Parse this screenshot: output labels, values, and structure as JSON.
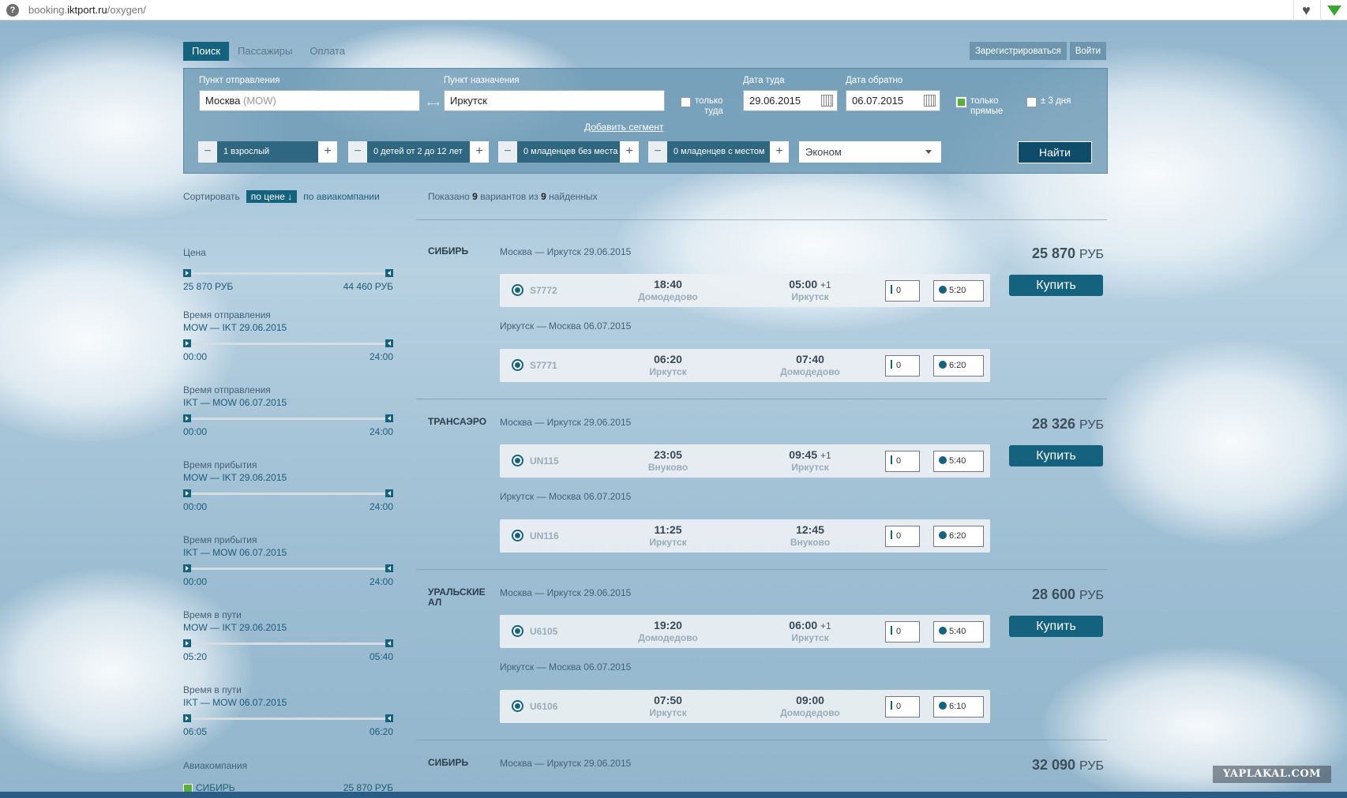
{
  "browser": {
    "url_prefix": "booking.",
    "url_domain": "iktport.ru",
    "url_path": "/oxygen/"
  },
  "tabs": [
    "Поиск",
    "Пассажиры",
    "Оплата"
  ],
  "auth": {
    "register": "Зарегистрироваться",
    "login": "Войти"
  },
  "search": {
    "from_label": "Пункт отправления",
    "from_value": "Москва",
    "from_code": "(MOW)",
    "to_label": "Пункт назначения",
    "to_value": "Иркутск",
    "one_way_line1": "только",
    "one_way_line2": "туда",
    "date_out_label": "Дата туда",
    "date_out": "29.06.2015",
    "date_back_label": "Дата обратно",
    "date_back": "06.07.2015",
    "direct_line1": "только",
    "direct_line2": "прямые",
    "plus_minus_3": "± 3 дня",
    "add_segment": "Добавить сегмент",
    "adults": "1 взрослый",
    "children": "0 детей от 2 до 12 лет",
    "infants_no_seat": "0 младенцев без места",
    "infants_seat": "0 младенцев с местом",
    "class": "Эконом",
    "find": "Найти"
  },
  "sort": {
    "label": "Сортировать",
    "by_price": "по цене ↓",
    "by_airline": "по авиакомпании"
  },
  "results_info": {
    "prefix": "Показано",
    "shown": "9",
    "middle": "вариантов из",
    "found": "9",
    "suffix": "найденных"
  },
  "filters": [
    {
      "title": "Цена",
      "subtitle": "",
      "min": "25 870 РУБ",
      "max": "44 460 РУБ"
    },
    {
      "title": "Время отправления",
      "subtitle": "MOW — IKT 29.06.2015",
      "min": "00:00",
      "max": "24:00"
    },
    {
      "title": "Время отправления",
      "subtitle": "IKT — MOW 06.07.2015",
      "min": "00:00",
      "max": "24:00"
    },
    {
      "title": "Время прибытия",
      "subtitle": "MOW — IKT 29.06.2015",
      "min": "00:00",
      "max": "24:00"
    },
    {
      "title": "Время прибытия",
      "subtitle": "IKT — MOW 06.07.2015",
      "min": "00:00",
      "max": "24:00"
    },
    {
      "title": "Время в пути",
      "subtitle": "MOW — IKT 29.06.2015",
      "min": "05:20",
      "max": "05:40"
    },
    {
      "title": "Время в пути",
      "subtitle": "IKT — MOW 06.07.2015",
      "min": "06:05",
      "max": "06:20"
    }
  ],
  "airline_filter": {
    "title": "Авиакомпания",
    "item": "СИБИРЬ",
    "price": "25 870 РУБ"
  },
  "offers": [
    {
      "airline": "СИБИРЬ",
      "price": "25 870",
      "currency": "РУБ",
      "buy": "Купить",
      "out": {
        "route": "Москва — Иркутск 29.06.2015",
        "num": "S7772",
        "dep": "18:40",
        "dep_ap": "Домодедово",
        "arr": "05:00",
        "plus": "+1",
        "arr_ap": "Иркутск",
        "stops": "0",
        "dur": "5:20"
      },
      "back": {
        "route": "Иркутск — Москва 06.07.2015",
        "num": "S7771",
        "dep": "06:20",
        "dep_ap": "Иркутск",
        "arr": "07:40",
        "plus": "",
        "arr_ap": "Домодедово",
        "stops": "0",
        "dur": "6:20"
      }
    },
    {
      "airline": "ТРАНСАЭРО",
      "price": "28 326",
      "currency": "РУБ",
      "buy": "Купить",
      "out": {
        "route": "Москва — Иркутск 29.06.2015",
        "num": "UN115",
        "dep": "23:05",
        "dep_ap": "Внуково",
        "arr": "09:45",
        "plus": "+1",
        "arr_ap": "Иркутск",
        "stops": "0",
        "dur": "5:40"
      },
      "back": {
        "route": "Иркутск — Москва 06.07.2015",
        "num": "UN116",
        "dep": "11:25",
        "dep_ap": "Иркутск",
        "arr": "12:45",
        "plus": "",
        "arr_ap": "Внуково",
        "stops": "0",
        "dur": "6:20"
      }
    },
    {
      "airline": "УРАЛЬСКИЕ АЛ",
      "price": "28 600",
      "currency": "РУБ",
      "buy": "Купить",
      "out": {
        "route": "Москва — Иркутск 29.06.2015",
        "num": "U6105",
        "dep": "19:20",
        "dep_ap": "Домодедово",
        "arr": "06:00",
        "plus": "+1",
        "arr_ap": "Иркутск",
        "stops": "0",
        "dur": "5:40"
      },
      "back": {
        "route": "Иркутск — Москва 06.07.2015",
        "num": "U6106",
        "dep": "07:50",
        "dep_ap": "Иркутск",
        "arr": "09:00",
        "plus": "",
        "arr_ap": "Домодедово",
        "stops": "0",
        "dur": "6:10"
      }
    },
    {
      "airline": "СИБИРЬ",
      "price": "32 090",
      "currency": "РУБ",
      "out": {
        "route": "Москва — Иркутск 29.06.2015"
      }
    }
  ],
  "watermark": "YAPLAKAL.COM",
  "colors": {
    "accent": "#14627e",
    "panel": "#6f9bb6",
    "direct_checkbox": "#58b03b"
  }
}
